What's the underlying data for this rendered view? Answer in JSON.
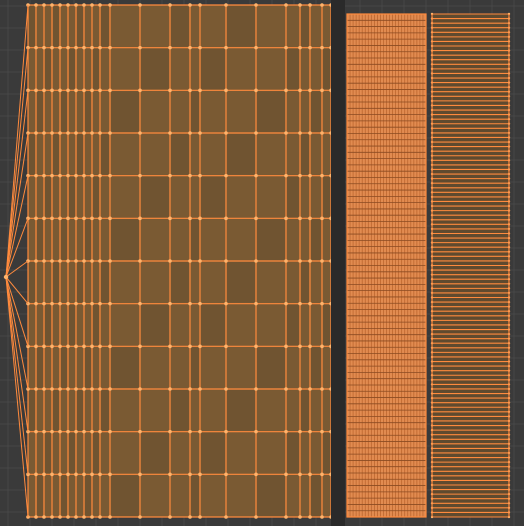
{
  "editor": {
    "name": "uv-editor",
    "background_color": "#3a3a3a",
    "grid_color": "#474747",
    "island_fill_color": "#7a5a33",
    "island_fill_alt_color": "#5f4a2f",
    "edge_color": "#ff8a3d",
    "vertex_color": "#ffb36b",
    "dense_fill_color": "#ff9a55",
    "divider_color": "#2a2a2a"
  },
  "islands": {
    "main_grid": {
      "name": "uv-island-main-grid",
      "columns": 17,
      "rows": 12
    },
    "dense_strip": {
      "name": "uv-island-dense-strip",
      "columns": 26,
      "rows": 80
    },
    "right_strip": {
      "name": "uv-island-right-strip",
      "columns": 1,
      "rows": 110
    }
  }
}
